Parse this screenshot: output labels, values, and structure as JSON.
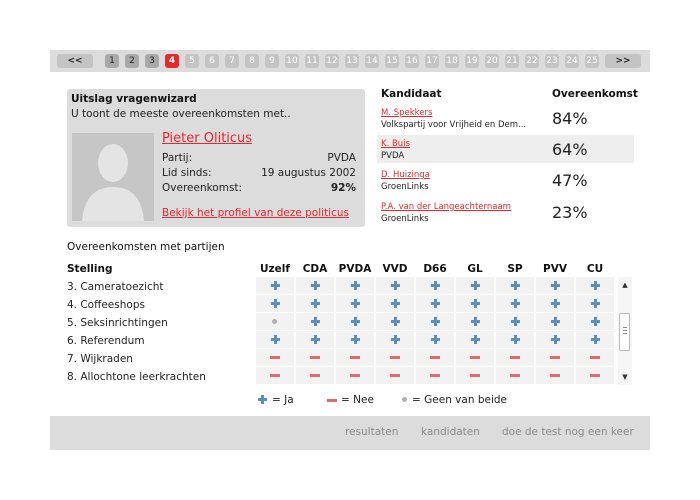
{
  "pager": {
    "prev": "<<",
    "next": ">>",
    "pages": [
      "1",
      "2",
      "3",
      "4",
      "5",
      "6",
      "7",
      "8",
      "9",
      "10",
      "11",
      "12",
      "13",
      "14",
      "15",
      "16",
      "17",
      "18",
      "19",
      "20",
      "21",
      "22",
      "23",
      "24",
      "25"
    ],
    "current": "4"
  },
  "profile": {
    "heading": "Uitslag vragenwizard",
    "subheading": "U toont de meeste overeenkomsten met..",
    "name": "Pieter Oliticus",
    "fields": [
      {
        "label": "Partij:",
        "value": "PVDA"
      },
      {
        "label": "Lid sinds:",
        "value": "19 augustus 2002"
      },
      {
        "label": "Overeenkomst:",
        "value": "92%"
      }
    ],
    "profile_link": "Bekijk het profiel van deze politicus"
  },
  "candidates": {
    "header_name": "Kandidaat",
    "header_match": "Overeenkomst",
    "rows": [
      {
        "name": "M. Spekkers",
        "party": "Volkspartij voor Vrijheid en Dem...",
        "match": "84%"
      },
      {
        "name": "K. Buis",
        "party": "PVDA",
        "match": "64%"
      },
      {
        "name": "D. Huizinga",
        "party": "GroenLinks",
        "match": "47%"
      },
      {
        "name": "P.A. van der Langeachternaam",
        "party": "GroenLinks",
        "match": "23%"
      }
    ]
  },
  "matrix": {
    "title": "Overeenkomsten met partijen",
    "row_header": "Stelling",
    "parties": [
      "Uzelf",
      "CDA",
      "PVDA",
      "VVD",
      "D66",
      "GL",
      "SP",
      "PVV",
      "CU"
    ],
    "rows": [
      {
        "label": "3. Cameratoezicht",
        "values": [
          "plus",
          "plus",
          "plus",
          "plus",
          "plus",
          "plus",
          "plus",
          "plus",
          "plus"
        ]
      },
      {
        "label": "4. Coffeeshops",
        "values": [
          "plus",
          "plus",
          "plus",
          "plus",
          "plus",
          "plus",
          "plus",
          "plus",
          "plus"
        ]
      },
      {
        "label": "5. Seksinrichtingen",
        "values": [
          "dot",
          "plus",
          "plus",
          "plus",
          "plus",
          "plus",
          "plus",
          "plus",
          "plus"
        ]
      },
      {
        "label": "6. Referendum",
        "values": [
          "plus",
          "plus",
          "plus",
          "plus",
          "plus",
          "plus",
          "plus",
          "plus",
          "plus"
        ]
      },
      {
        "label": "7. Wijkraden",
        "values": [
          "min",
          "min",
          "min",
          "min",
          "min",
          "min",
          "min",
          "min",
          "min"
        ]
      },
      {
        "label": "8. Allochtone leerkrachten",
        "values": [
          "min",
          "min",
          "min",
          "min",
          "min",
          "min",
          "min",
          "min",
          "min"
        ]
      }
    ]
  },
  "legend": {
    "yes": "= Ja",
    "no": "= Nee",
    "neither": "= Geen van beide"
  },
  "footer": {
    "results": "resultaten",
    "candidates": "kandidaten",
    "retake": "doe de test nog een keer"
  },
  "colors": {
    "accent": "#e8262c",
    "plus": "#5b8fc0",
    "minus": "#e06a72",
    "neutral": "#b0b0b0"
  }
}
